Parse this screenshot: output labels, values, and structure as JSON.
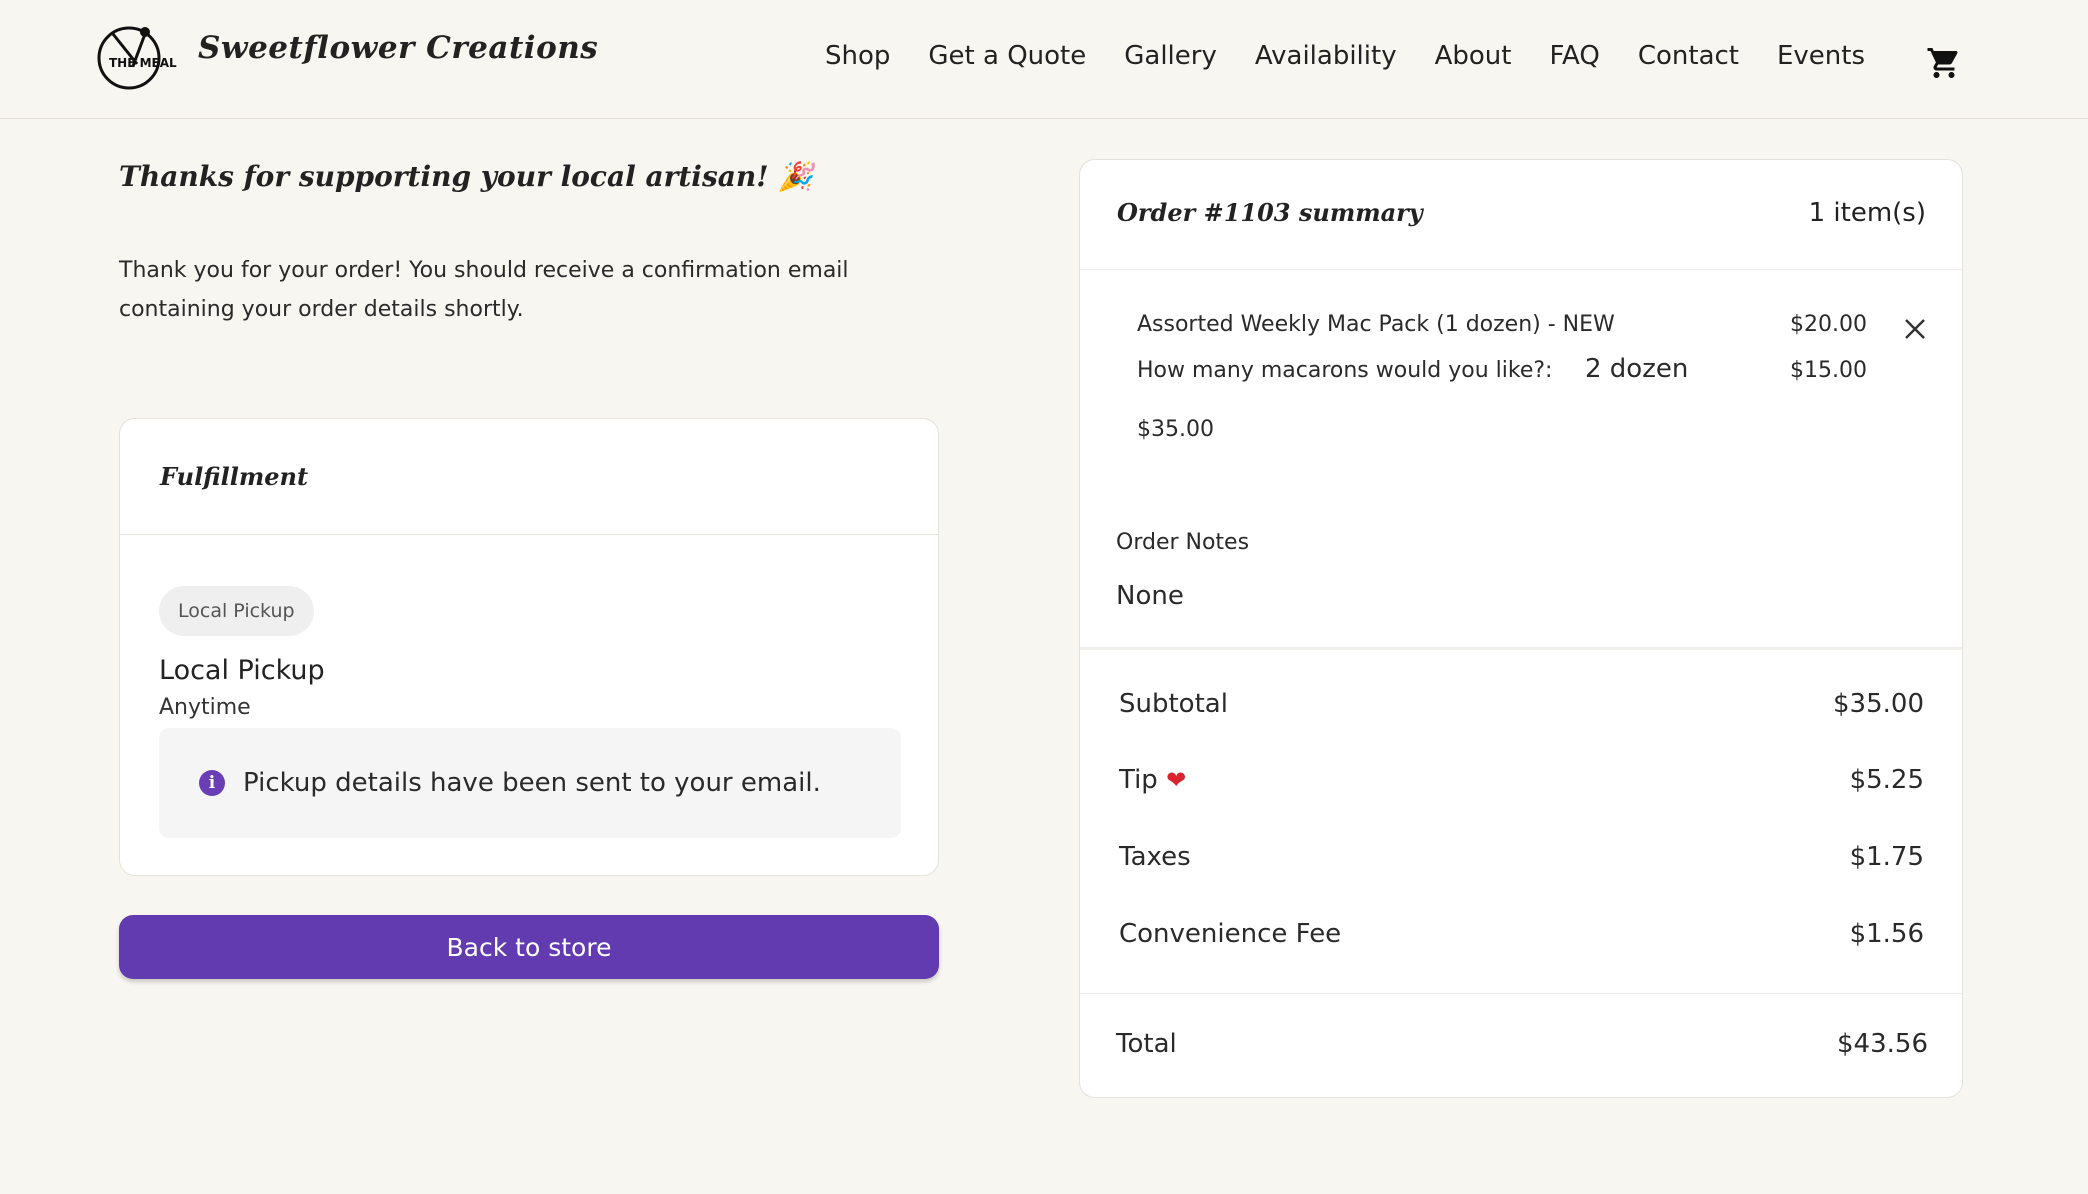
{
  "header": {
    "logo_text": "THE MEAL",
    "brand": "Sweetflower Creations",
    "nav": [
      "Shop",
      "Get a Quote",
      "Gallery",
      "Availability",
      "About",
      "FAQ",
      "Contact",
      "Events"
    ]
  },
  "confirmation": {
    "title": "Thanks for supporting your local artisan! 🎉",
    "message": "Thank you for your order! You should receive a confirmation email containing your order details shortly."
  },
  "fulfillment": {
    "heading": "Fulfillment",
    "badge": "Local Pickup",
    "method": "Local Pickup",
    "time": "Anytime",
    "info": "Pickup details have been sent to your email."
  },
  "back_button": "Back to store",
  "summary": {
    "title": "Order #1103 summary",
    "count": "1 item(s)",
    "item": {
      "name": "Assorted Weekly Mac Pack (1 dozen) - NEW",
      "price": "$20.00",
      "option_label": "How many macarons would you like?:",
      "option_value": "2 dozen",
      "option_price": "$15.00",
      "line_total": "$35.00"
    },
    "notes_label": "Order Notes",
    "notes_value": "None",
    "rows": {
      "subtotal_label": "Subtotal",
      "subtotal_value": "$35.00",
      "tip_label": "Tip",
      "tip_value": "$5.25",
      "taxes_label": "Taxes",
      "taxes_value": "$1.75",
      "fee_label": "Convenience Fee",
      "fee_value": "$1.56"
    },
    "total_label": "Total",
    "total_value": "$43.56"
  },
  "colors": {
    "accent": "#623bb0",
    "background": "#f8f6f1"
  }
}
